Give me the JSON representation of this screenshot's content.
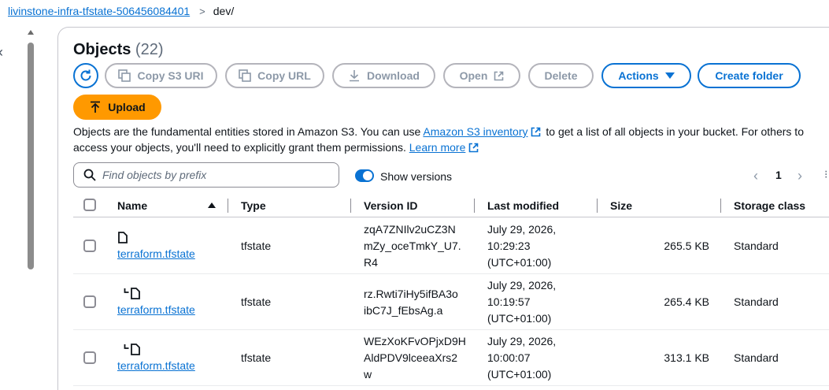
{
  "breadcrumb": {
    "bucket": "livinstone-infra-tfstate-506456084401",
    "separator": ">",
    "current": "dev/"
  },
  "panel": {
    "title": "Objects",
    "count": "(22)"
  },
  "toolbar": {
    "copy_s3_uri": "Copy S3 URI",
    "copy_url": "Copy URL",
    "download": "Download",
    "open": "Open",
    "delete": "Delete",
    "actions": "Actions",
    "create_folder": "Create folder",
    "upload": "Upload"
  },
  "description": {
    "text1": "Objects are the fundamental entities stored in Amazon S3. You can use ",
    "link1": "Amazon S3 inventory",
    "text2": " to get a list of all objects in your bucket. For others to access your objects, you'll need to explicitly grant them permissions. ",
    "link2": "Learn more"
  },
  "search": {
    "placeholder": "Find objects by prefix"
  },
  "versions_toggle": {
    "label": "Show versions",
    "checked": true
  },
  "pagination": {
    "prev": "‹",
    "page": "1",
    "next": "›"
  },
  "table": {
    "columns": [
      "Name",
      "Type",
      "Version ID",
      "Last modified",
      "Size",
      "Storage class"
    ],
    "rows": [
      {
        "name": "terraform.tfstate",
        "type": "tfstate",
        "version_id": [
          "zqA7ZNIlv2uCZ3N",
          "mZy_oceTmkY_U7.",
          "R4"
        ],
        "last_modified": [
          "July 29, 2026,",
          "10:29:23",
          "(UTC+01:00)"
        ],
        "size": "265.5 KB",
        "storage_class": "Standard",
        "is_version": false
      },
      {
        "name": "terraform.tfstate",
        "type": "tfstate",
        "version_id": [
          "rz.Rwti7iHy5ifBA3o",
          "ibC7J_fEbsAg.a"
        ],
        "last_modified": [
          "July 29, 2026,",
          "10:19:57",
          "(UTC+01:00)"
        ],
        "size": "265.4 KB",
        "storage_class": "Standard",
        "is_version": true
      },
      {
        "name": "terraform.tfstate",
        "type": "tfstate",
        "version_id": [
          "WEzXoKFvOPjxD9H",
          "AldPDV9lceeaXrs2",
          "w"
        ],
        "last_modified": [
          "July 29, 2026,",
          "10:00:07",
          "(UTC+01:00)"
        ],
        "size": "313.1 KB",
        "storage_class": "Standard",
        "is_version": true
      }
    ]
  },
  "colors": {
    "link": "#0972d3",
    "upload": "#ff9900",
    "disabled": "#8d99a8"
  }
}
